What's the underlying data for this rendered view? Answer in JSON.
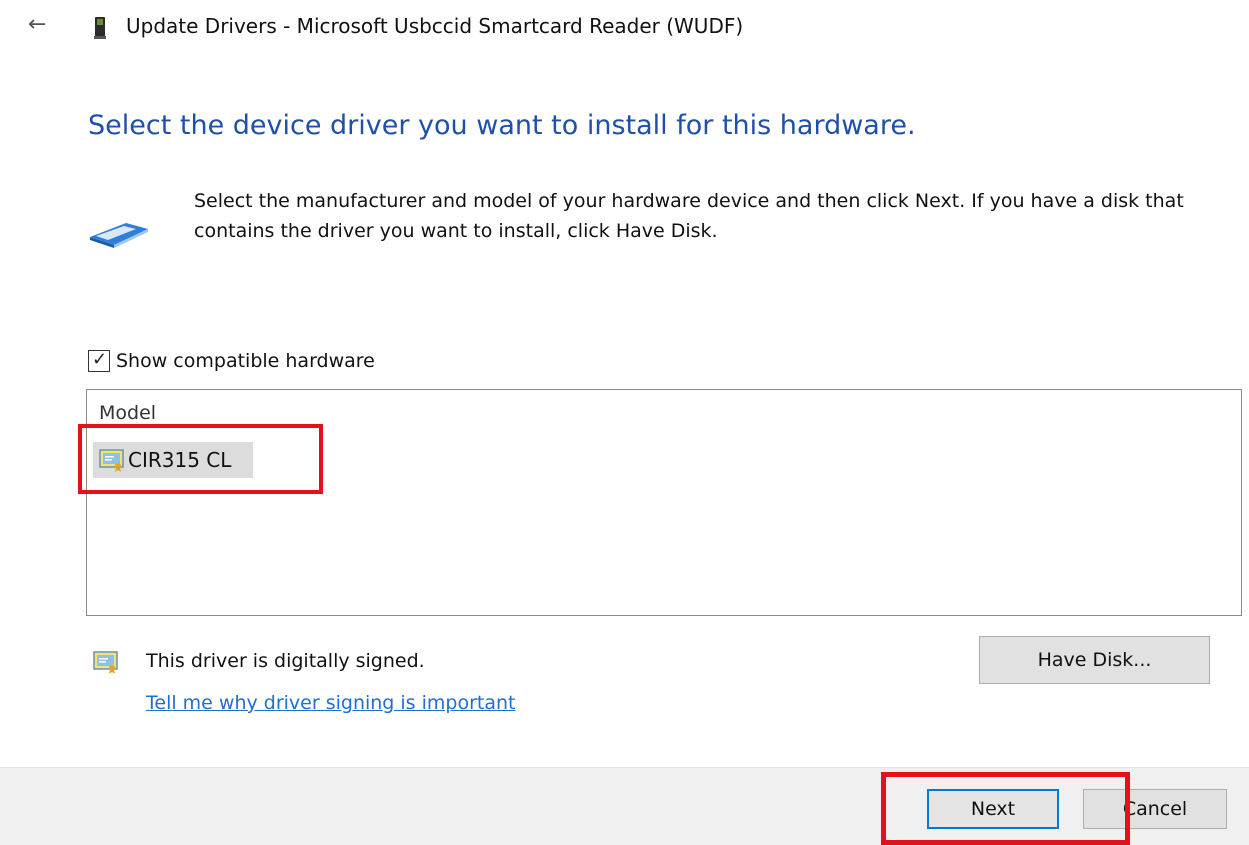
{
  "window": {
    "title": "Update Drivers - Microsoft Usbccid Smartcard Reader (WUDF)",
    "back_icon": "back-arrow-icon"
  },
  "heading": "Select the device driver you want to install for this hardware.",
  "description": "Select the manufacturer and model of your hardware device and then click Next. If you have a disk that contains the driver you want to install, click Have Disk.",
  "compatible_checkbox": {
    "label": "Show compatible hardware",
    "checked": true
  },
  "model_list": {
    "header": "Model",
    "items": [
      {
        "label": "CIR315 CL",
        "selected": true
      }
    ]
  },
  "signing": {
    "status_text": "This driver is digitally signed.",
    "link_text": "Tell me why driver signing is important"
  },
  "buttons": {
    "have_disk": "Have Disk...",
    "next": "Next",
    "cancel": "Cancel"
  },
  "colors": {
    "heading": "#1f4fa8",
    "link": "#1e6fcf",
    "highlight_box": "#e4111b",
    "default_button_border": "#0078d7"
  }
}
